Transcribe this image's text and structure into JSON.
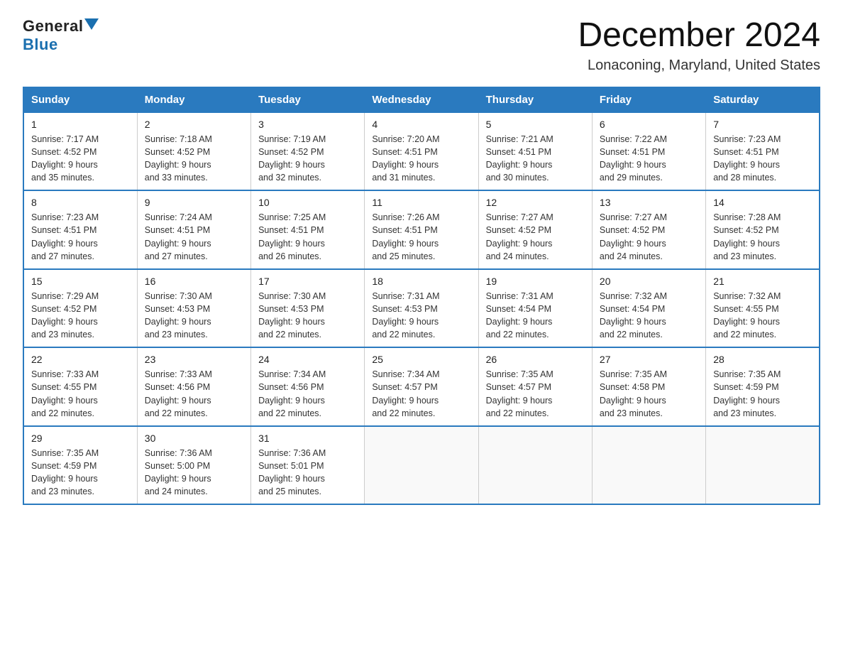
{
  "logo": {
    "general": "General",
    "blue": "Blue"
  },
  "title": "December 2024",
  "location": "Lonaconing, Maryland, United States",
  "days_of_week": [
    "Sunday",
    "Monday",
    "Tuesday",
    "Wednesday",
    "Thursday",
    "Friday",
    "Saturday"
  ],
  "weeks": [
    [
      {
        "day": "1",
        "sunrise": "7:17 AM",
        "sunset": "4:52 PM",
        "daylight": "9 hours and 35 minutes."
      },
      {
        "day": "2",
        "sunrise": "7:18 AM",
        "sunset": "4:52 PM",
        "daylight": "9 hours and 33 minutes."
      },
      {
        "day": "3",
        "sunrise": "7:19 AM",
        "sunset": "4:52 PM",
        "daylight": "9 hours and 32 minutes."
      },
      {
        "day": "4",
        "sunrise": "7:20 AM",
        "sunset": "4:51 PM",
        "daylight": "9 hours and 31 minutes."
      },
      {
        "day": "5",
        "sunrise": "7:21 AM",
        "sunset": "4:51 PM",
        "daylight": "9 hours and 30 minutes."
      },
      {
        "day": "6",
        "sunrise": "7:22 AM",
        "sunset": "4:51 PM",
        "daylight": "9 hours and 29 minutes."
      },
      {
        "day": "7",
        "sunrise": "7:23 AM",
        "sunset": "4:51 PM",
        "daylight": "9 hours and 28 minutes."
      }
    ],
    [
      {
        "day": "8",
        "sunrise": "7:23 AM",
        "sunset": "4:51 PM",
        "daylight": "9 hours and 27 minutes."
      },
      {
        "day": "9",
        "sunrise": "7:24 AM",
        "sunset": "4:51 PM",
        "daylight": "9 hours and 27 minutes."
      },
      {
        "day": "10",
        "sunrise": "7:25 AM",
        "sunset": "4:51 PM",
        "daylight": "9 hours and 26 minutes."
      },
      {
        "day": "11",
        "sunrise": "7:26 AM",
        "sunset": "4:51 PM",
        "daylight": "9 hours and 25 minutes."
      },
      {
        "day": "12",
        "sunrise": "7:27 AM",
        "sunset": "4:52 PM",
        "daylight": "9 hours and 24 minutes."
      },
      {
        "day": "13",
        "sunrise": "7:27 AM",
        "sunset": "4:52 PM",
        "daylight": "9 hours and 24 minutes."
      },
      {
        "day": "14",
        "sunrise": "7:28 AM",
        "sunset": "4:52 PM",
        "daylight": "9 hours and 23 minutes."
      }
    ],
    [
      {
        "day": "15",
        "sunrise": "7:29 AM",
        "sunset": "4:52 PM",
        "daylight": "9 hours and 23 minutes."
      },
      {
        "day": "16",
        "sunrise": "7:30 AM",
        "sunset": "4:53 PM",
        "daylight": "9 hours and 23 minutes."
      },
      {
        "day": "17",
        "sunrise": "7:30 AM",
        "sunset": "4:53 PM",
        "daylight": "9 hours and 22 minutes."
      },
      {
        "day": "18",
        "sunrise": "7:31 AM",
        "sunset": "4:53 PM",
        "daylight": "9 hours and 22 minutes."
      },
      {
        "day": "19",
        "sunrise": "7:31 AM",
        "sunset": "4:54 PM",
        "daylight": "9 hours and 22 minutes."
      },
      {
        "day": "20",
        "sunrise": "7:32 AM",
        "sunset": "4:54 PM",
        "daylight": "9 hours and 22 minutes."
      },
      {
        "day": "21",
        "sunrise": "7:32 AM",
        "sunset": "4:55 PM",
        "daylight": "9 hours and 22 minutes."
      }
    ],
    [
      {
        "day": "22",
        "sunrise": "7:33 AM",
        "sunset": "4:55 PM",
        "daylight": "9 hours and 22 minutes."
      },
      {
        "day": "23",
        "sunrise": "7:33 AM",
        "sunset": "4:56 PM",
        "daylight": "9 hours and 22 minutes."
      },
      {
        "day": "24",
        "sunrise": "7:34 AM",
        "sunset": "4:56 PM",
        "daylight": "9 hours and 22 minutes."
      },
      {
        "day": "25",
        "sunrise": "7:34 AM",
        "sunset": "4:57 PM",
        "daylight": "9 hours and 22 minutes."
      },
      {
        "day": "26",
        "sunrise": "7:35 AM",
        "sunset": "4:57 PM",
        "daylight": "9 hours and 22 minutes."
      },
      {
        "day": "27",
        "sunrise": "7:35 AM",
        "sunset": "4:58 PM",
        "daylight": "9 hours and 23 minutes."
      },
      {
        "day": "28",
        "sunrise": "7:35 AM",
        "sunset": "4:59 PM",
        "daylight": "9 hours and 23 minutes."
      }
    ],
    [
      {
        "day": "29",
        "sunrise": "7:35 AM",
        "sunset": "4:59 PM",
        "daylight": "9 hours and 23 minutes."
      },
      {
        "day": "30",
        "sunrise": "7:36 AM",
        "sunset": "5:00 PM",
        "daylight": "9 hours and 24 minutes."
      },
      {
        "day": "31",
        "sunrise": "7:36 AM",
        "sunset": "5:01 PM",
        "daylight": "9 hours and 25 minutes."
      },
      null,
      null,
      null,
      null
    ]
  ],
  "labels": {
    "sunrise": "Sunrise:",
    "sunset": "Sunset:",
    "daylight": "Daylight:"
  }
}
